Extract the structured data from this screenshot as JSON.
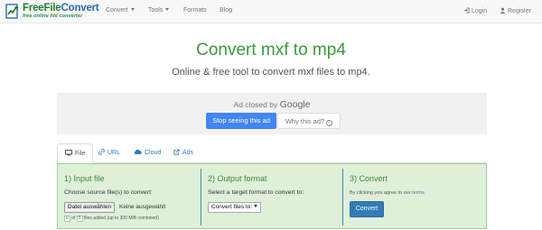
{
  "brand": {
    "name_part1": "FreeFile",
    "name_part2": "Convert",
    "tagline": "free online file converter",
    "logo_color": "#1d7a2d"
  },
  "nav": {
    "items": [
      {
        "label": "Convert",
        "has_caret": true
      },
      {
        "label": "Tools",
        "has_caret": true
      },
      {
        "label": "Formats",
        "has_caret": false
      },
      {
        "label": "Blog",
        "has_caret": false
      }
    ],
    "login": {
      "label": "Login",
      "icon": "login-icon"
    },
    "register": {
      "label": "Register",
      "icon": "user-icon"
    }
  },
  "hero": {
    "title": "Convert mxf to mp4",
    "subtitle": "Online & free tool to convert mxf files to mp4.",
    "accent_color": "#3a9a3a"
  },
  "ad": {
    "closed_text": "Ad closed by",
    "provider": "Google",
    "stop_label": "Stop seeing this ad",
    "why_label": "Why this ad?",
    "stop_color": "#4285f4"
  },
  "tabs": [
    {
      "label": "File",
      "icon": "monitor-icon",
      "active": true
    },
    {
      "label": "URL",
      "icon": "link-icon",
      "active": false
    },
    {
      "label": "Cloud",
      "icon": "cloud-icon",
      "active": false
    },
    {
      "label": "Ads",
      "icon": "external-link-icon",
      "active": false
    }
  ],
  "steps": {
    "input": {
      "title": "1) Input file",
      "instruction": "Choose source file(s) to convert:",
      "file_button": "Datei auswählen",
      "file_status": "Keine ausgewählt",
      "count_current": "0",
      "count_of": "of",
      "count_max": "5",
      "count_suffix": "files added (up to 300 MiB combined)"
    },
    "output": {
      "title": "2) Output format",
      "instruction": "Select a target format to convert to:",
      "select_value": "Convert files to:"
    },
    "convert": {
      "title": "3) Convert",
      "terms_prefix": "By clicking you agree to our",
      "terms_link": "terms",
      "button_label": "Convert",
      "button_color": "#337ab7"
    }
  },
  "panel_color": "#dff0d8"
}
